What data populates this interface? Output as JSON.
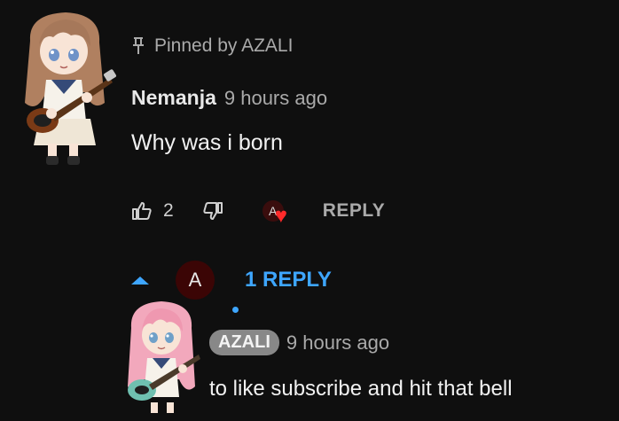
{
  "pinned": {
    "text": "Pinned by AZALI",
    "icon": "pin-icon"
  },
  "comment": {
    "author": "Nemanja",
    "time": "9 hours ago",
    "text": "Why was i born",
    "likes": "2",
    "reply_label": "REPLY",
    "creator_avatar_letter": "A"
  },
  "replies_toggle": {
    "label": "1 REPLY",
    "avatar_letter": "A"
  },
  "reply": {
    "author": "AZALI",
    "time": "9 hours ago",
    "text": "to like subscribe and hit that bell"
  },
  "colors": {
    "accent_blue": "#3ea6ff",
    "heart_red": "#ff2a2a",
    "background": "#0f0f0f"
  }
}
